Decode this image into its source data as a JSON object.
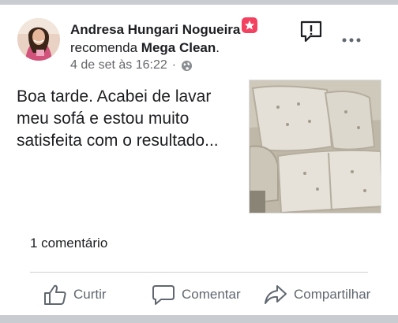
{
  "post": {
    "author": "Andresa Hungari Nogueira",
    "recommend_verb": "recomenda",
    "page_name": "Mega Clean",
    "page_suffix": ".",
    "timestamp": "4 de set às 16:22",
    "separator": "·",
    "privacy_icon": "globe-icon",
    "text": "Boa tarde. Acabei de lavar meu sofá e estou muito satisfeita com o resultado...",
    "photo": "sofa-photo",
    "badge_color": "#f3425f"
  },
  "stats": {
    "comments": "1 comentário"
  },
  "actions": {
    "like": "Curtir",
    "comment": "Comentar",
    "share": "Compartilhar"
  }
}
